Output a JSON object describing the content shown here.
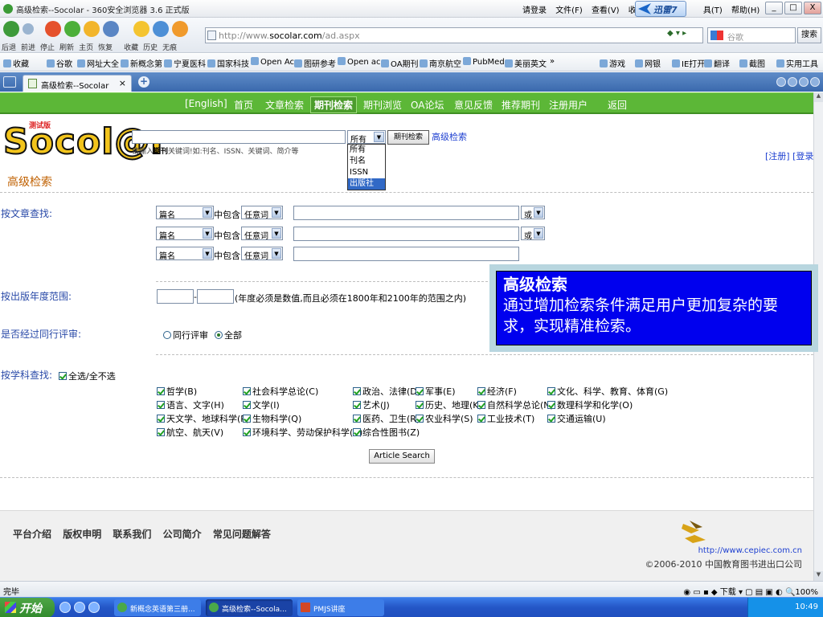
{
  "window": {
    "title": "高级检索--Socolar - 360安全浏览器 3.6 正式版",
    "menu": [
      "请登录",
      "文件(F)",
      "查看(V)",
      "收藏(",
      "具(T)",
      "帮助(H)"
    ],
    "thunder_label": "迅雷7",
    "controls": [
      "_",
      "□",
      "X"
    ]
  },
  "nav": {
    "labels": [
      "后退",
      "前进",
      "停止",
      "刷新",
      "主页",
      "恢复",
      "收藏",
      "历史",
      "无痕"
    ],
    "address_prefix": "http://www.",
    "address_domain": "socolar.com",
    "address_suffix": "/ad.aspx",
    "search_placeholder": "谷歌",
    "search_button": "搜索"
  },
  "favorites": [
    "收藏",
    "谷歌",
    "网址大全",
    "新概念第",
    "宁夏医科",
    "国家科技",
    "Open Ac",
    "图研参考",
    "Open ac",
    "OA期刊",
    "南京航空",
    "PubMed",
    "美丽英文",
    "»",
    "游戏",
    "网银",
    "IE打开",
    "翻译",
    "截图",
    "实用工具"
  ],
  "tab": {
    "label": "高级检索--Socolar",
    "close": "×",
    "new": "+"
  },
  "site_nav": [
    "[English]",
    "首页",
    "文章检索",
    "期刊检索",
    "期刊浏览",
    "OA论坛",
    "意见反馈",
    "推荐期刊",
    "注册用户",
    "返回"
  ],
  "header": {
    "logo": "Socol@r",
    "beta": "测试版",
    "hint_prefix": "请输入",
    "hint_bold": "期刊",
    "hint_suffix": "关键词!如:刊名、ISSN、关键词、简介等",
    "select_value": "所有",
    "select_options": [
      "所有",
      "刊名",
      "ISSN",
      "出版社"
    ],
    "search_button": "期刊检索",
    "advanced_link": "高级检索",
    "register": "[注册]",
    "login": "[登录]"
  },
  "advanced": {
    "title": "高级检索",
    "article_label": "按文章查找:",
    "rows": [
      {
        "field": "篇名",
        "contains": "中包含",
        "match": "任意词",
        "op": "或"
      },
      {
        "field": "篇名",
        "contains": "中包含",
        "match": "任意词",
        "op": "或"
      },
      {
        "field": "篇名",
        "contains": "中包含",
        "match": "任意词",
        "op": ""
      }
    ],
    "year_label": "按出版年度范围:",
    "year_sep": "-",
    "year_note": "(年度必须是数值,而且必须在1800年和2100年的范围之内)",
    "peer_label": "是否经过同行评审:",
    "peer_options": [
      "同行评审",
      "全部"
    ],
    "subject_label": "按学科查找:",
    "select_all": "全选/全不选",
    "subjects": [
      [
        "哲学(B)",
        "社会科学总论(C)",
        "政治、法律(D)",
        "军事(E)",
        "经济(F)",
        "文化、科学、教育、体育(G)"
      ],
      [
        "语言、文字(H)",
        "文学(I)",
        "艺术(J)",
        "历史、地理(K)",
        "自然科学总论(N)",
        "数理科学和化学(O)"
      ],
      [
        "天文学、地球科学(P)",
        "生物科学(Q)",
        "医药、卫生(R)",
        "农业科学(S)",
        "工业技术(T)",
        "交通运输(U)"
      ],
      [
        "航空、航天(V)",
        "环境科学、劳动保护科学(X)",
        "综合性图书(Z)"
      ]
    ],
    "submit": "Article Search"
  },
  "footer": {
    "links": [
      "平台介绍",
      "版权申明",
      "联系我们",
      "公司简介",
      "常见问题解答"
    ],
    "url": "http://www.cepiec.com.cn",
    "copyright": "©2006-2010 中国教育图书进出口公司"
  },
  "callout": {
    "title": "高级检索",
    "body": "通过增加检索条件满足用户更加复杂的要求，实现精准检索。"
  },
  "status": {
    "left": "完毕",
    "download": "下载",
    "zoom": "100%"
  },
  "taskbar": {
    "start": "开始",
    "tasks": [
      "新概念英语第三册...",
      "高级检索--Socola...",
      "PMJS讲座"
    ],
    "clock": "10:49"
  },
  "colors": {
    "site_green": "#5cb737",
    "callout_blue": "#0000ee",
    "link_blue": "#1d3fd0",
    "title_orange": "#c06000"
  }
}
